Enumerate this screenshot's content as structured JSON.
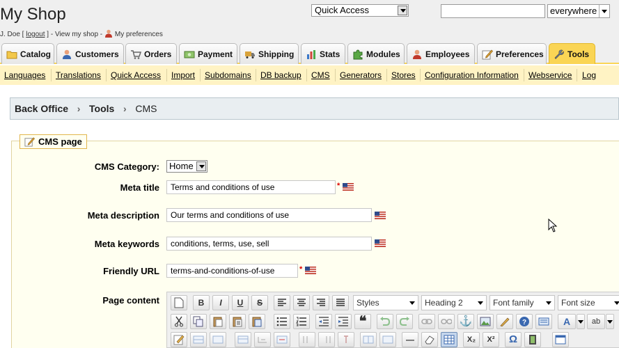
{
  "header": {
    "shop_name": "My Shop",
    "user_name": "J. Doe [",
    "logout_label": "logout",
    "after_logout": "] - View my shop -",
    "preferences_label": "My preferences",
    "quick_access_label": "Quick Access",
    "search_value": "",
    "search_scope": "everywhere"
  },
  "tabs": [
    {
      "label": "Catalog",
      "icon": "folder-icon"
    },
    {
      "label": "Customers",
      "icon": "person-icon"
    },
    {
      "label": "Orders",
      "icon": "cart-icon"
    },
    {
      "label": "Payment",
      "icon": "money-icon"
    },
    {
      "label": "Shipping",
      "icon": "truck-icon"
    },
    {
      "label": "Stats",
      "icon": "bar-chart-icon"
    },
    {
      "label": "Modules",
      "icon": "puzzle-icon"
    },
    {
      "label": "Employees",
      "icon": "person-icon"
    },
    {
      "label": "Preferences",
      "icon": "edit-icon"
    },
    {
      "label": "Tools",
      "icon": "wrench-icon",
      "active": true
    }
  ],
  "subtabs": [
    "Languages",
    "Translations",
    "Quick Access",
    "Import",
    "Subdomains",
    "DB backup",
    "CMS",
    "Generators",
    "Stores",
    "Configuration Information",
    "Webservice",
    "Log"
  ],
  "breadcrumb": {
    "items": [
      "Back Office",
      "Tools",
      "CMS"
    ],
    "separator": "›"
  },
  "form": {
    "legend": "CMS page",
    "category_label": "CMS Category:",
    "category_value": "Home",
    "meta_title_label": "Meta title",
    "meta_title_value": "Terms and conditions of use",
    "meta_description_label": "Meta description",
    "meta_description_value": "Our terms and conditions of use",
    "meta_keywords_label": "Meta keywords",
    "meta_keywords_value": "conditions, terms, use, sell",
    "friendly_url_label": "Friendly URL",
    "friendly_url_value": "terms-and-conditions-of-use",
    "page_content_label": "Page content",
    "required_mark": "*"
  },
  "editor": {
    "styles_label": "Styles",
    "format_label": "Heading 2",
    "font_family_label": "Font family",
    "font_size_label": "Font size",
    "bold": "B",
    "italic": "I",
    "underline": "U",
    "strike": "S",
    "quote": "❝",
    "anchor": "⚓",
    "omega": "Ω",
    "hr": "—",
    "sub": "X₂",
    "sup": "X²",
    "font_color": "A",
    "bg_color": "ab"
  },
  "colors": {
    "active_tab": "#fad555",
    "subnav_bg": "#fff3c4",
    "fieldset_bg": "#fffff0",
    "breadcrumb_bg": "#e9eef1"
  }
}
